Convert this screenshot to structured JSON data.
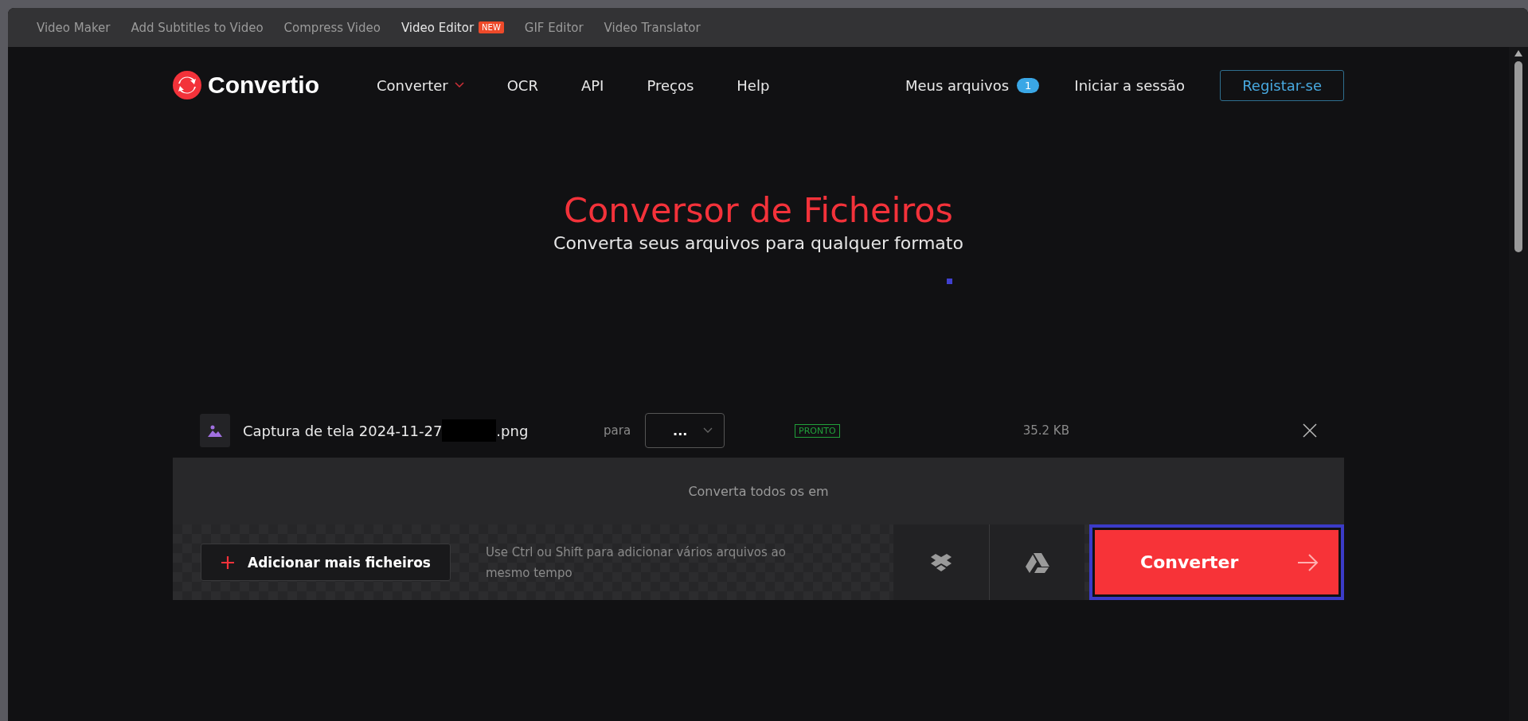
{
  "top_tabs": [
    {
      "label": "Video Maker",
      "selected": false
    },
    {
      "label": "Add Subtitles to Video",
      "selected": false
    },
    {
      "label": "Compress Video",
      "selected": false
    },
    {
      "label": "Video Editor",
      "selected": true,
      "badge": "NEW"
    },
    {
      "label": "GIF Editor",
      "selected": false
    },
    {
      "label": "Video Translator",
      "selected": false
    }
  ],
  "header": {
    "logo": "Convertio",
    "nav": [
      {
        "label": "Converter",
        "kind": "dropdown"
      },
      {
        "label": "OCR",
        "kind": "link"
      },
      {
        "label": "API",
        "kind": "link"
      },
      {
        "label": "Preços",
        "kind": "link"
      },
      {
        "label": "Help",
        "kind": "link"
      }
    ],
    "my_files": {
      "label": "Meus arquivos",
      "count": "1"
    },
    "login": "Iniciar a sessão",
    "register": "Registar-se"
  },
  "hero": {
    "title": "Conversor de Ficheiros",
    "subtitle": "Converta seus arquivos para qualquer formato"
  },
  "files": [
    {
      "name_start": "Captura de tela 2024-11-27",
      "redacted": true,
      "name_end": ".png",
      "to_label": "para",
      "format": "...",
      "status": "PRONTO",
      "size": "35.2 KB"
    }
  ],
  "convert_all": "Converta todos os em",
  "actions": {
    "add_button": "Adicionar mais ficheiros",
    "hint": "Use Ctrl ou Shift para adicionar vários arquivos ao mesmo tempo",
    "convert_button": {
      "label": "Converter",
      "focused": true
    }
  }
}
